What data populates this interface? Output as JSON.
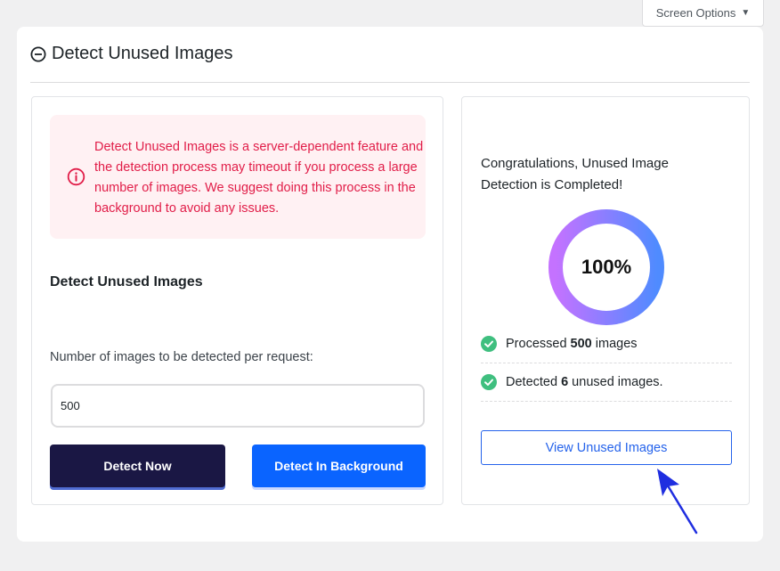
{
  "screen_options": {
    "label": "Screen Options",
    "caret_icon": "caret-down-icon"
  },
  "panel": {
    "title": "Detect Unused Images",
    "toggle_icon": "minus-circle-icon"
  },
  "alert": {
    "icon": "info-circle-icon",
    "text": "Detect Unused Images is a server-dependent feature and the detection process may timeout if you process a large number of images. We suggest doing this process in the background to avoid any issues.",
    "color": "#e11d48",
    "background": "#fff1f3"
  },
  "settings": {
    "section_title": "Detect Unused Images",
    "field_label": "Number of images to be detected per request:",
    "field_value": "500"
  },
  "buttons": {
    "detect_now": "Detect Now",
    "detect_background": "Detect In Background"
  },
  "result": {
    "congrats": "Congratulations, Unused Image Detection is Completed!",
    "progress_label": "100%",
    "progress_fraction": 1.0,
    "stats": {
      "processed_prefix": "Processed ",
      "processed_count": "500",
      "processed_suffix": " images",
      "detected_prefix": "Detected ",
      "detected_count": "6",
      "detected_suffix": " unused images."
    },
    "view_button": "View Unused Images"
  },
  "colors": {
    "accent_blue": "#0a64ff",
    "dark_navy": "#1a1744",
    "success_green": "#3fbf7f",
    "ring_start": "#c472ff",
    "ring_end": "#4f8bff",
    "annotation_arrow": "#1f2ee0"
  }
}
